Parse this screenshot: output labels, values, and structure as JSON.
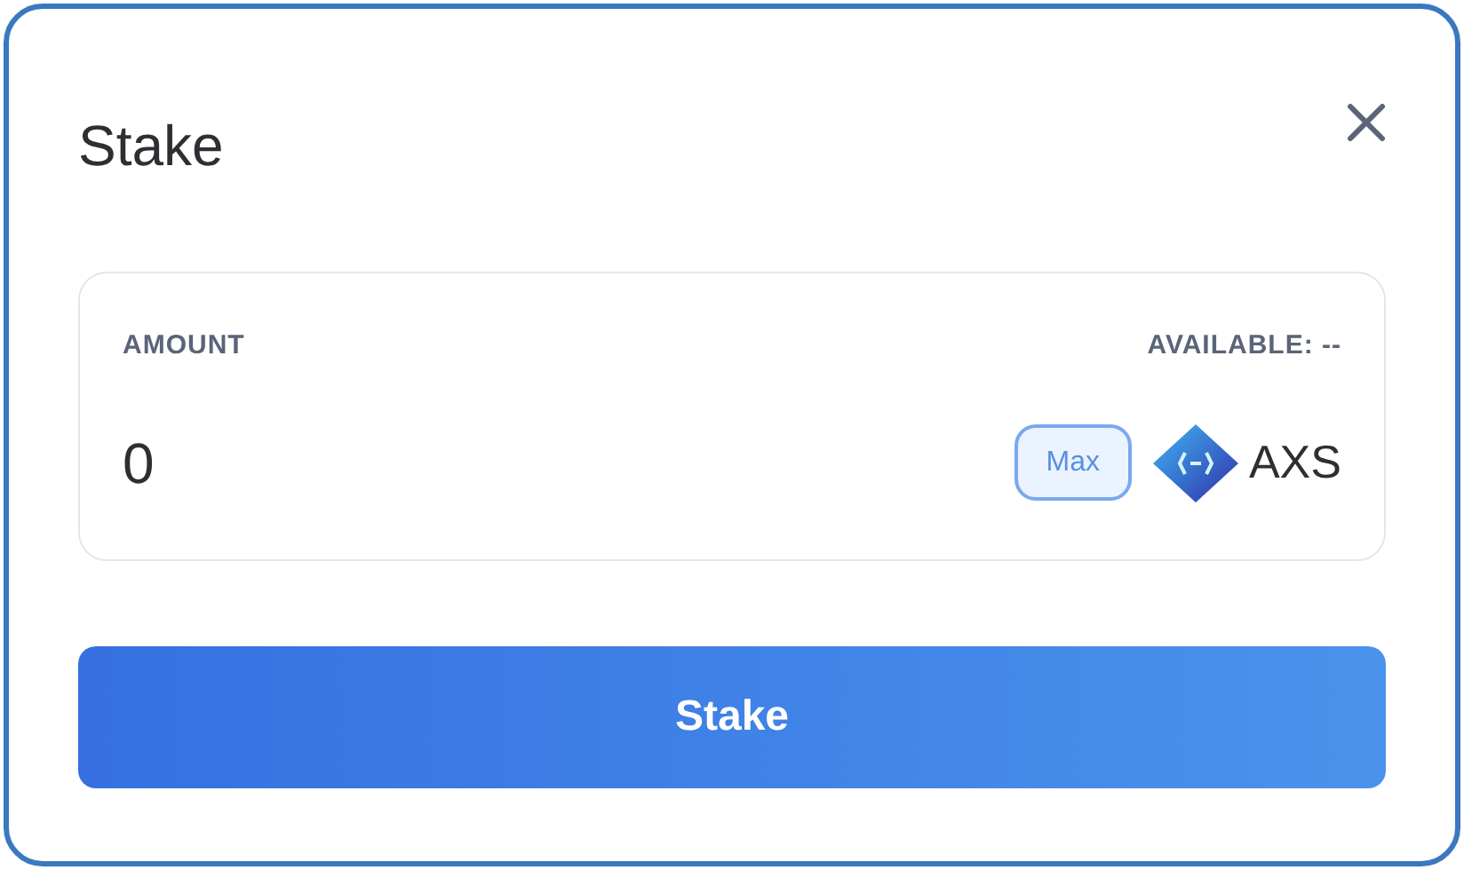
{
  "dialog": {
    "title": "Stake"
  },
  "amount": {
    "label": "AMOUNT",
    "available": "AVAILABLE: --",
    "value": "0",
    "max_button": "Max",
    "token": "AXS"
  },
  "submit_button": "Stake"
}
